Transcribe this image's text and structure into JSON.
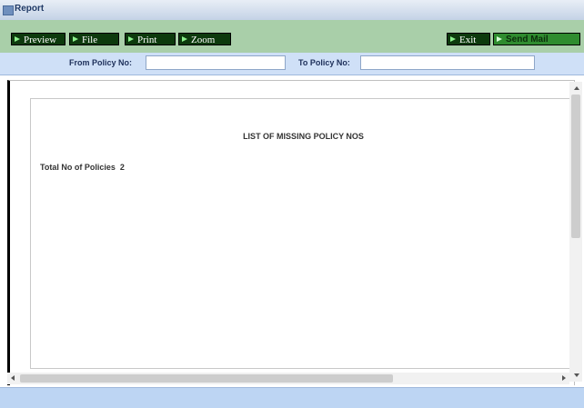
{
  "window": {
    "title": "Report"
  },
  "toolbar": {
    "preview": "Preview",
    "file": "File",
    "print": "Print",
    "zoom": "Zoom",
    "exit": "Exit",
    "send_mail": "Send Mail"
  },
  "filters": {
    "from_label": "From Policy No:",
    "from_value": "",
    "to_label": "To Policy No:",
    "to_value": ""
  },
  "report": {
    "title": "LIST OF MISSING POLICY NOS",
    "total_label": "Total No of Policies",
    "total_value": "2"
  }
}
